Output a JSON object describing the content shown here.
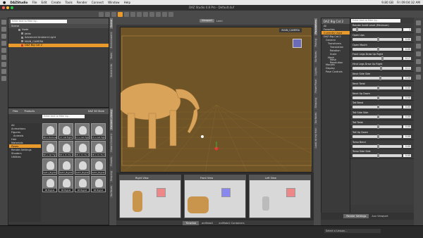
{
  "menubar": {
    "apple": "",
    "app": "DAZStudio",
    "items": [
      "File",
      "Edit",
      "Create",
      "Tools",
      "Render",
      "Connect",
      "Window",
      "Help"
    ],
    "status_right": [
      "9.80 GB",
      "Fri 09:04:32 AM"
    ]
  },
  "window": {
    "title": "DAZ Studio 4.8 Pro - Default.duf"
  },
  "scene": {
    "search_placeholder": "Enter text to filter by...",
    "header": "Scene",
    "items": [
      {
        "label": "Node"
      },
      {
        "label": "Jaldo"
      },
      {
        "label": "Advanced Ambient Light"
      },
      {
        "label": "MAIN_CAMERA"
      },
      {
        "label": "DAZ Big Cat 2",
        "selected": true
      }
    ]
  },
  "left_tabs": [
    "Scene",
    "Environment",
    "Tools",
    "Scene Info"
  ],
  "content": {
    "tabs": [
      "Files",
      "Products",
      "DAZ 3D Store"
    ],
    "search_placeholder": "Enter text to filter by...",
    "all": "All",
    "categories": [
      "Animations",
      "Figures",
      "Animals",
      "Hair",
      "Materials",
      "Poses",
      "Render-Settings",
      "Shaders",
      "Utilities"
    ],
    "selected_category": "Poses",
    "thumbs": [
      "SB is Dominance",
      "17 Cat Fight",
      "17 is Cat Fight",
      "15 is Cat Fight",
      "SB is Cat Fight",
      "SB is On the Roll",
      "SB is On the Roll",
      "SB is On the Roll",
      "Sw01_BigCat",
      "Sw02_BigCat",
      "Sw03_BigCat",
      "Sw04_BigCat",
      "SB BigCat",
      "SB BigCat",
      "SB BigCat",
      "SB BigCat"
    ]
  },
  "left_tabs2": [
    "Content Library",
    "Smart Content",
    "Presets",
    "Shaping",
    "Surfaces"
  ],
  "viewport": {
    "tabs": [
      "Viewport",
      "Lenti"
    ],
    "camera": "MAIN_CAMERA"
  },
  "aux": {
    "views": [
      "Right View",
      "Front View",
      "Left View"
    ]
  },
  "bottom_tabs": [
    "Timeline",
    "aniMate2",
    "aniMate2 Containers"
  ],
  "mid_tabs": [
    "Parameters",
    "Posing",
    "Surfaces",
    "Lights",
    "PowerPose",
    "Shaping",
    "Surfaces",
    "Look at my Hair"
  ],
  "params": {
    "header": "DAZ Big Cat 2",
    "search_placeholder": "Enter text to filter by...",
    "all": "All",
    "favorites": "Favorites",
    "currently_used": "Currently Used",
    "tree": [
      "DAZ Big Cat 2",
      "General",
      "Transforms",
      "Translation",
      "Rotation",
      "Scale",
      "Mesh",
      "Mesh Resolution",
      "Morphs",
      "Display",
      "Pose Controls"
    ],
    "show_subitems": "Show Sub-Items"
  },
  "sliders": [
    {
      "label": "Render SubD Level (Minimum)",
      "value": "1"
    },
    {
      "label": "Open Lips",
      "value": "0.00"
    },
    {
      "label": "Open Mouth",
      "value": "0.00"
    },
    {
      "label": "Front Legs Draw Up Right",
      "value": "0.17"
    },
    {
      "label": "Hind Legs Draw Up Right",
      "value": "0.11"
    },
    {
      "label": "Neck Side Side",
      "value": "0.09"
    },
    {
      "label": "Neck Twist",
      "value": "0.00"
    },
    {
      "label": "Neck Up Down",
      "value": "0.00"
    },
    {
      "label": "Tail Bend",
      "value": "0.00"
    },
    {
      "label": "Tail Side Side",
      "value": "0.00"
    },
    {
      "label": "Tail Twist",
      "value": "0.00"
    },
    {
      "label": "Tail Up Down",
      "value": "0.00"
    },
    {
      "label": "Torso Bend",
      "value": "0.00"
    },
    {
      "label": "Torso Side Side",
      "value": "0.00"
    }
  ],
  "right_bottom_tabs": [
    "Render Settings",
    "Aux Viewport"
  ],
  "status": {
    "lesson_placeholder": "Select a Lesson..."
  },
  "colors": {
    "accent": "#e89a2c",
    "viewport_bg": "#6e5426",
    "lion": "#d9a35a"
  }
}
